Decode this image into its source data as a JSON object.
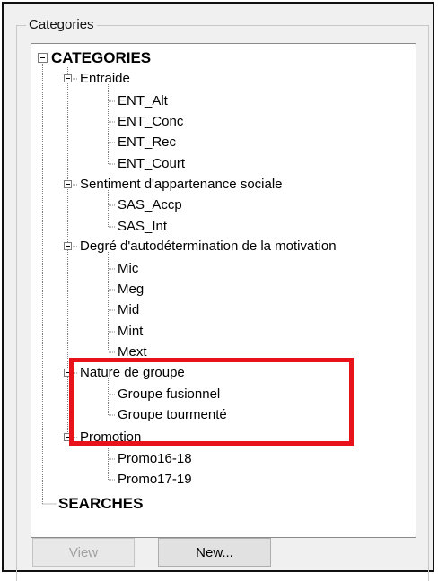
{
  "group": {
    "title": "Categories"
  },
  "tree": {
    "root": "CATEGORIES",
    "groups": [
      {
        "label": "Entraide",
        "items": [
          "ENT_Alt",
          "ENT_Conc",
          "ENT_Rec",
          "ENT_Court"
        ]
      },
      {
        "label": "Sentiment d'appartenance sociale",
        "items": [
          "SAS_Accp",
          "SAS_Int"
        ]
      },
      {
        "label": "Degré d'autodétermination de la motivation",
        "items": [
          "Mic",
          "Meg",
          "Mid",
          "Mint",
          "Mext"
        ]
      },
      {
        "label": "Nature de groupe",
        "items": [
          "Groupe fusionnel",
          "Groupe tourmenté"
        ]
      },
      {
        "label": "Promotion",
        "items": [
          "Promo16-18",
          "Promo17-19"
        ]
      }
    ],
    "searches": "SEARCHES"
  },
  "buttons": {
    "view": "View",
    "new": "New..."
  },
  "colors": {
    "highlight": "#e8121b",
    "panel": "#f0f0f0"
  }
}
